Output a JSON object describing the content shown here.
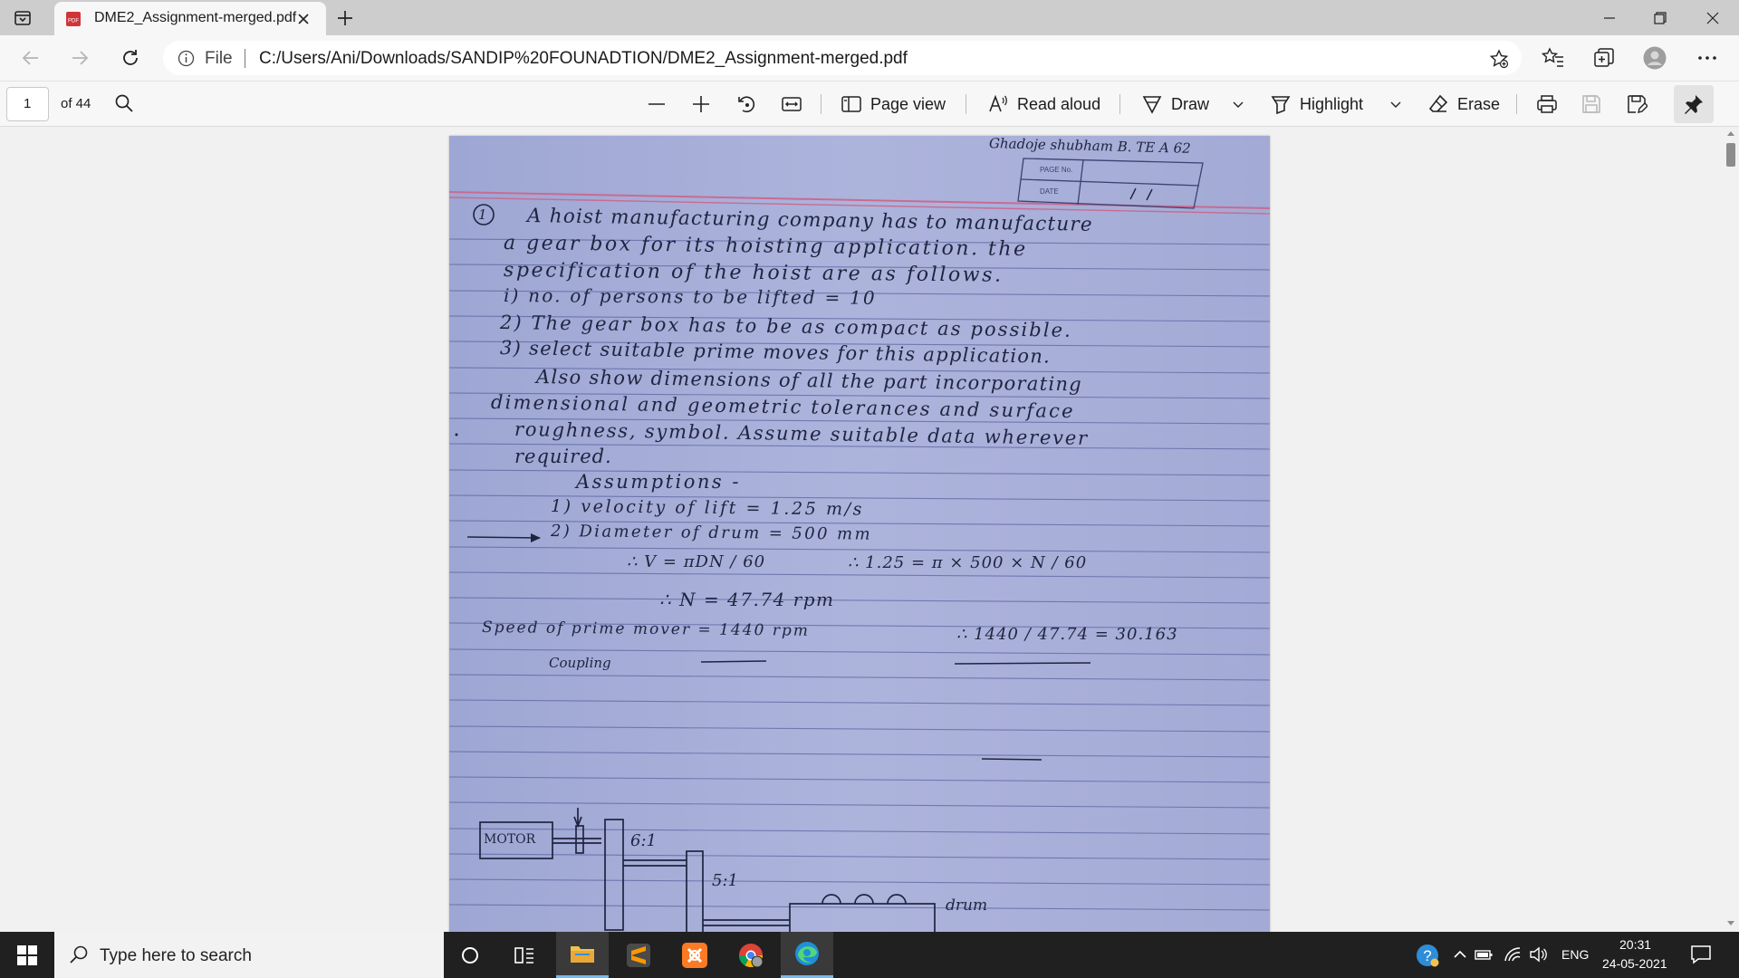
{
  "browser": {
    "tab_title": "DME2_Assignment-merged.pdf",
    "file_label": "File",
    "url": "C:/Users/Ani/Downloads/SANDIP%20FOUNADTION/DME2_Assignment-merged.pdf"
  },
  "pdf_toolbar": {
    "page_number": "1",
    "page_count": "of 44",
    "page_view_label": "Page view",
    "read_aloud_label": "Read aloud",
    "draw_label": "Draw",
    "highlight_label": "Highlight",
    "erase_label": "Erase"
  },
  "document": {
    "header_name": "Ghadoje shubham B. TE A 62",
    "page_no_label": "PAGE No.",
    "date_label": "DATE",
    "lines": [
      "A hoist manufacturing company has to manufacture",
      "a gear box for its hoisting application. the",
      "specification of the hoist are as follows.",
      "i) no. of persons to be lifted = 10",
      "2) The gear box has to be as compact as possible.",
      "3) select suitable prime moves for this application.",
      "Also show dimensions of all the part incorporating",
      "dimensional and geometric tolerances and surface",
      "roughness, symbol. Assume suitable data wherever",
      "required."
    ],
    "assumptions_title": "Assumptions -",
    "assumption_1": "1) velocity of lift = 1.25 m/s",
    "assumption_2": "2) Diameter of drum = 500 mm",
    "formula_lhs": "∴ V = πDN / 60",
    "formula_rhs": "∴ 1.25 = π × 500 × N / 60",
    "rpm_result": "∴ N = 47.74 rpm",
    "prime_mover_speed": "Speed of prime mover = 1440 rpm",
    "ratio": "∴ 1440 / 47.74 = 30.163",
    "sketch": {
      "coupling": "Coupling",
      "motor": "MOTOR",
      "stage1": "6:1",
      "stage2": "5:1",
      "drum": "drum"
    }
  },
  "taskbar": {
    "search_placeholder": "Type here to search",
    "language": "ENG",
    "time": "20:31",
    "date": "24-05-2021"
  }
}
